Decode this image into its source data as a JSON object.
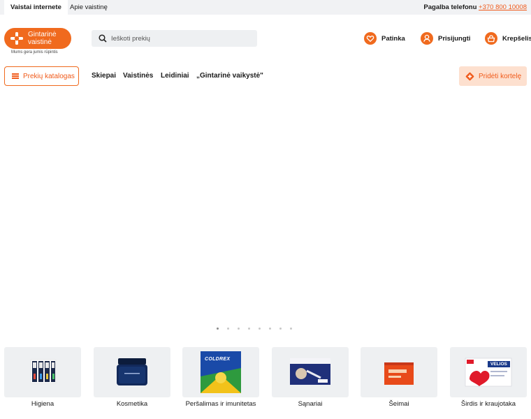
{
  "topbar": {
    "tabs": [
      {
        "label": "Vaistai internete",
        "active": true
      },
      {
        "label": "Apie vaistinę",
        "active": false
      }
    ],
    "help_label": "Pagalba telefonu",
    "help_phone": "+370 800 10008"
  },
  "logo": {
    "line1": "Gintarinė",
    "line2": "vaistinė",
    "tagline": "Mums gera jumis rūpintis"
  },
  "search": {
    "placeholder": "Ieškoti prekių"
  },
  "header_links": {
    "favorites": "Patinka",
    "login": "Prisijungti",
    "cart": "Krepšelis"
  },
  "nav": {
    "catalog": "Prekių katalogas",
    "links": [
      "Skiepai",
      "Vaistinės",
      "Leidiniai",
      "„Gintarinė vaikystė\""
    ],
    "add_card": "Pridėti kortelę"
  },
  "carousel": {
    "dot_count": 8,
    "active_index": 0
  },
  "categories": [
    {
      "label": "Higiena",
      "icon": "toothbrushes-image"
    },
    {
      "label": "Kosmetika",
      "icon": "cream-jar-image"
    },
    {
      "label": "Peršalimas ir imunitetas",
      "icon": "coldrex-box-image"
    },
    {
      "label": "Sąnariai",
      "icon": "joint-product-box-image"
    },
    {
      "label": "Šeimai",
      "icon": "family-product-box-image"
    },
    {
      "label": "Širdis ir kraujotaka",
      "icon": "velios-box-image"
    }
  ],
  "colors": {
    "brand_orange": "#f06a1e",
    "topbar_bg": "#f1f2f4",
    "tile_bg": "#eef0f2",
    "card_button_bg": "#fde0cf"
  }
}
